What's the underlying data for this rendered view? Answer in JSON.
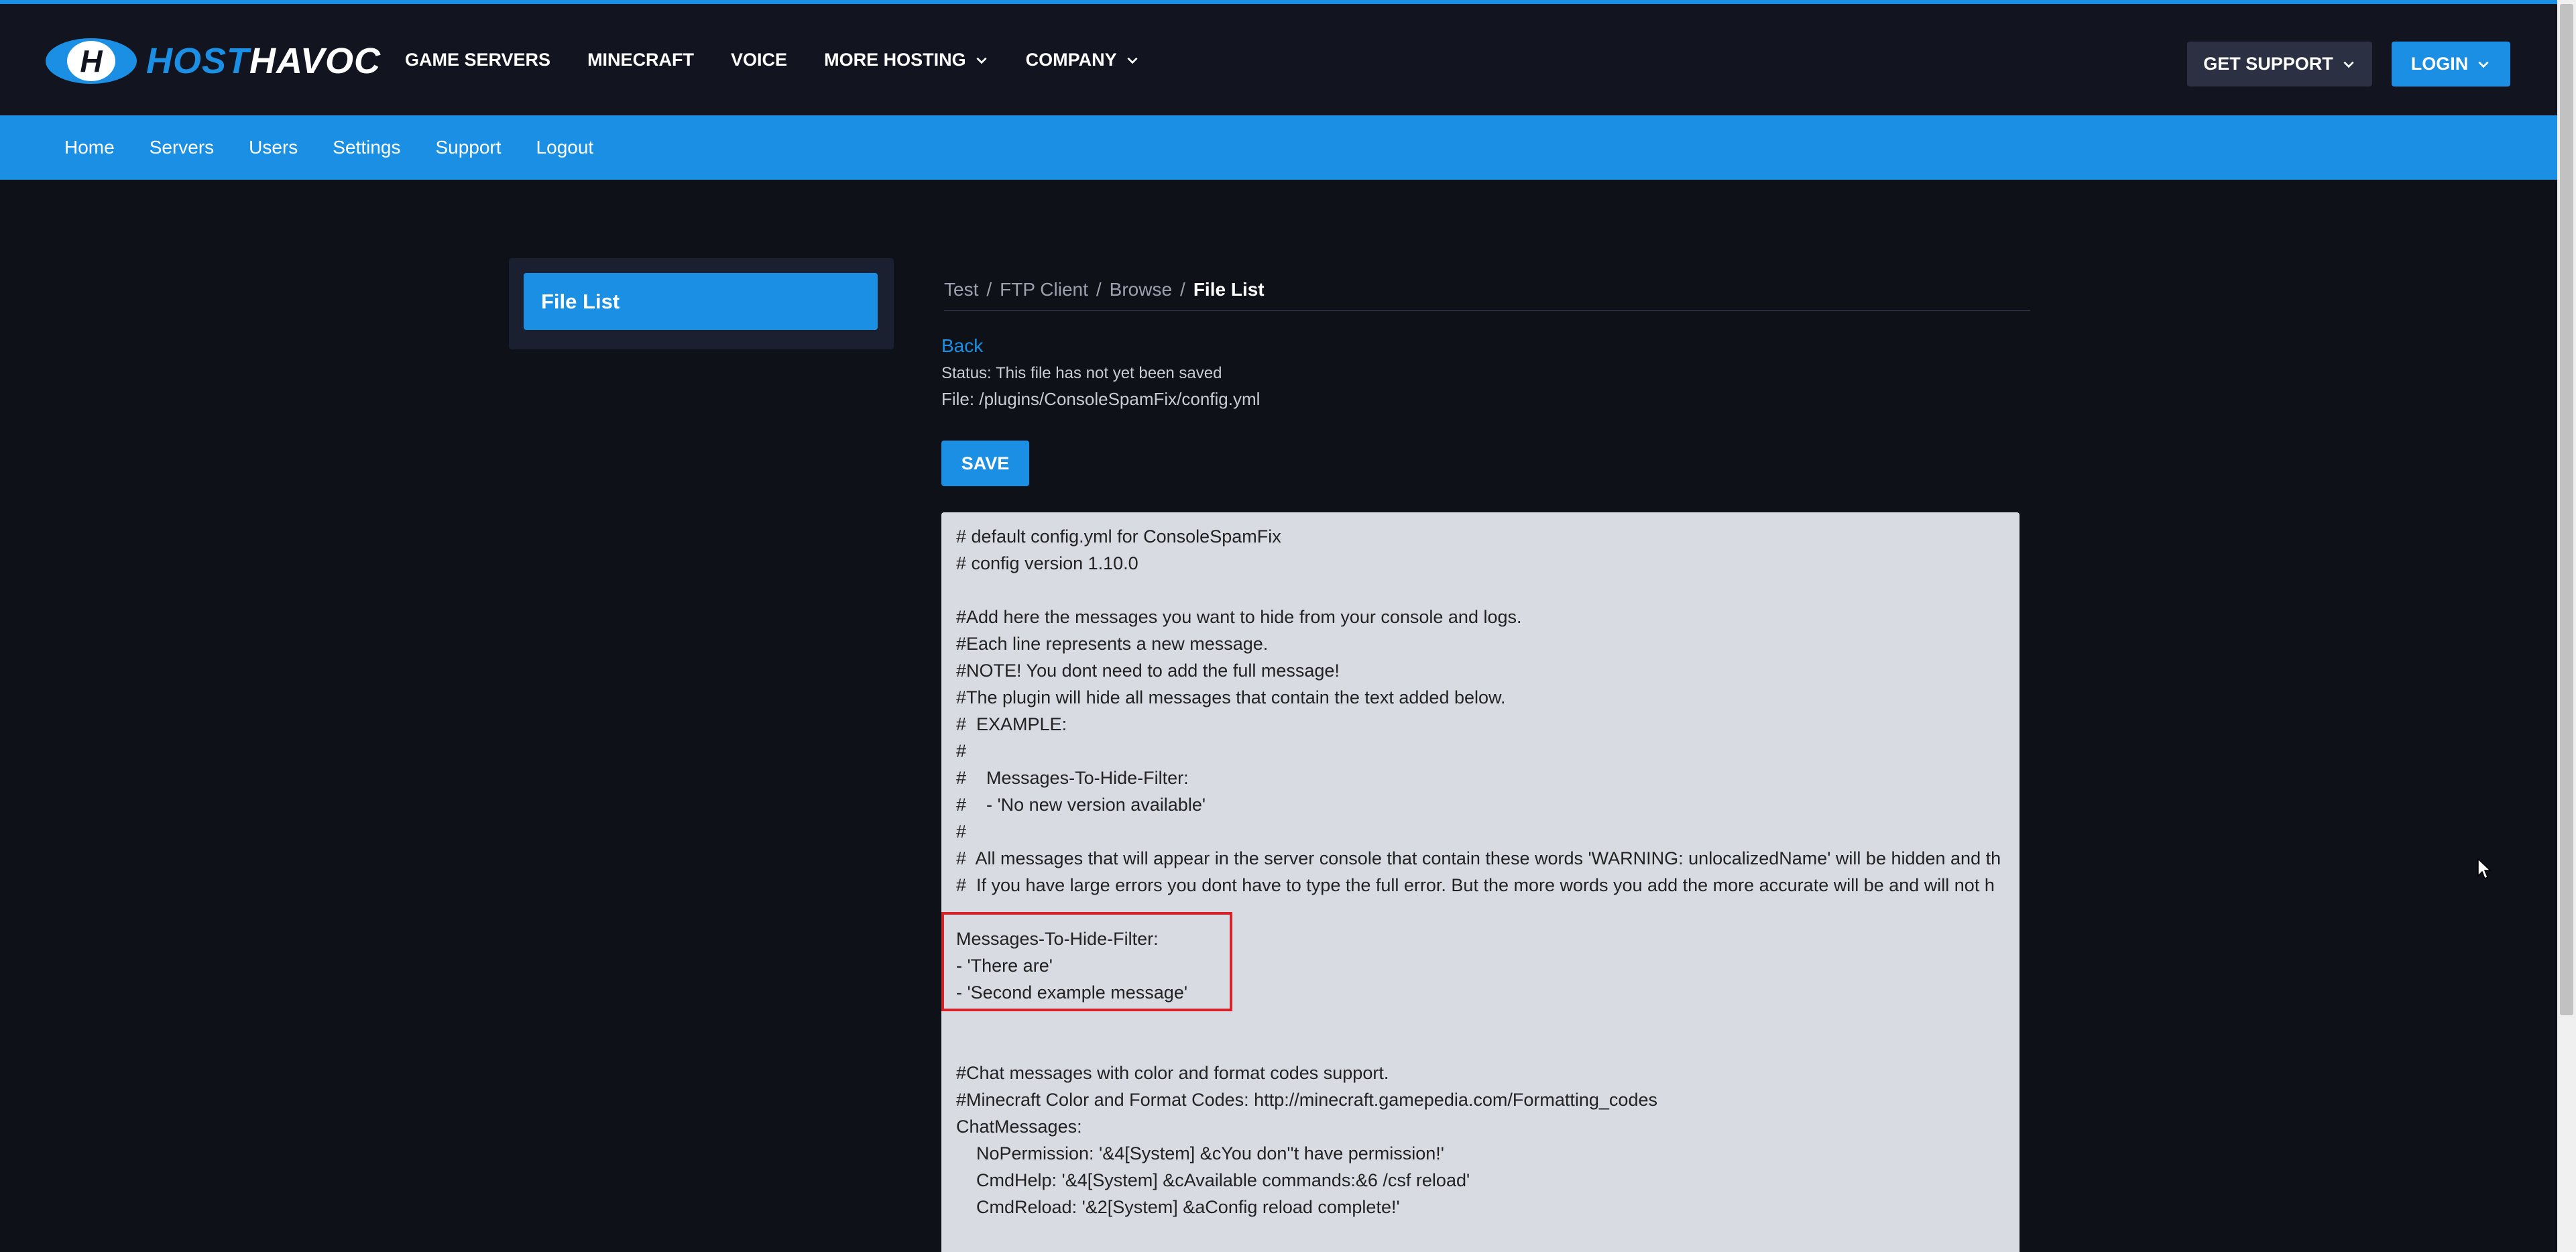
{
  "header": {
    "logo": {
      "host": "HOST",
      "havoc": "HAVOC"
    },
    "nav": [
      {
        "label": "GAME SERVERS",
        "dropdown": false
      },
      {
        "label": "MINECRAFT",
        "dropdown": false
      },
      {
        "label": "VOICE",
        "dropdown": false
      },
      {
        "label": "MORE HOSTING",
        "dropdown": true
      },
      {
        "label": "COMPANY",
        "dropdown": true
      }
    ],
    "support_label": "GET SUPPORT",
    "login_label": "LOGIN"
  },
  "subnav": {
    "links": [
      "Home",
      "Servers",
      "Users",
      "Settings",
      "Support",
      "Logout"
    ]
  },
  "sidebar": {
    "active_label": "File List"
  },
  "breadcrumb": {
    "items": [
      "Test",
      "FTP Client",
      "Browse"
    ],
    "current": "File List"
  },
  "content": {
    "back_label": "Back",
    "status": "Status: This file has not yet been saved",
    "file": "File: /plugins/ConsoleSpamFix/config.yml",
    "save_label": "SAVE"
  },
  "editor": {
    "lines": [
      "# default config.yml for ConsoleSpamFix",
      "# config version 1.10.0",
      "",
      "#Add here the messages you want to hide from your console and logs.",
      "#Each line represents a new message.",
      "#NOTE! You dont need to add the full message!",
      "#The plugin will hide all messages that contain the text added below.",
      "#  EXAMPLE:",
      "#",
      "#    Messages-To-Hide-Filter:",
      "#    - 'No new version available'",
      "#",
      "#  All messages that will appear in the server console that contain these words 'WARNING: unlocalizedName' will be hidden and th",
      "#  If you have large errors you dont have to type the full error. But the more words you add the more accurate will be and will not h",
      "",
      "Messages-To-Hide-Filter:",
      "- 'There are'",
      "- 'Second example message'",
      "",
      "",
      "#Chat messages with color and format codes support.",
      "#Minecraft Color and Format Codes: http://minecraft.gamepedia.com/Formatting_codes",
      "ChatMessages:",
      "    NoPermission: '&4[System] &cYou don''t have permission!'",
      "    CmdHelp: '&4[System] &cAvailable commands:&6 /csf reload'",
      "    CmdReload: '&2[System] &aConfig reload complete!'"
    ]
  },
  "colors": {
    "accent": "#1a8fe3",
    "background": "#0f1119",
    "header": "#121520",
    "editor_bg": "#d9dbe2",
    "highlight": "#d4232b"
  }
}
